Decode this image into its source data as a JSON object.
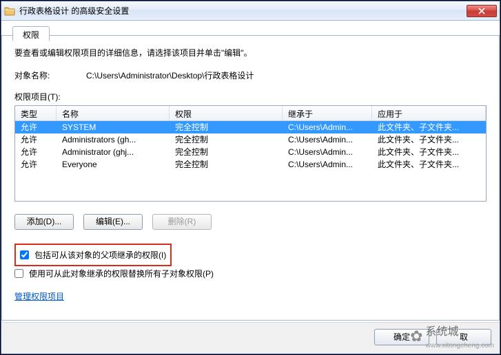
{
  "window": {
    "title": "行政表格设计 的高级安全设置"
  },
  "tab": {
    "label": "权限"
  },
  "instruction": "要查看或编辑权限项目的详细信息，请选择该项目并单击\"编辑\"。",
  "object": {
    "label": "对象名称:",
    "value": "C:\\Users\\Administrator\\Desktop\\行政表格设计"
  },
  "permlist": {
    "label": "权限项目(T):",
    "columns": {
      "type": "类型",
      "name": "名称",
      "perm": "权限",
      "inherit": "继承于",
      "apply": "应用于"
    },
    "rows": [
      {
        "type": "允许",
        "name": "SYSTEM",
        "perm": "完全控制",
        "inherit": "C:\\Users\\Admin...",
        "apply": "此文件夹、子文件夹..."
      },
      {
        "type": "允许",
        "name": "Administrators (gh...",
        "perm": "完全控制",
        "inherit": "C:\\Users\\Admin...",
        "apply": "此文件夹、子文件夹..."
      },
      {
        "type": "允许",
        "name": "Administrator (ghj...",
        "perm": "完全控制",
        "inherit": "C:\\Users\\Admin...",
        "apply": "此文件夹、子文件夹..."
      },
      {
        "type": "允许",
        "name": "Everyone",
        "perm": "完全控制",
        "inherit": "C:\\Users\\Admin...",
        "apply": "此文件夹、子文件夹..."
      }
    ]
  },
  "buttons": {
    "add": "添加(D)...",
    "edit": "编辑(E)...",
    "remove": "删除(R)"
  },
  "checkboxes": {
    "include_inherit": "包括可从该对象的父项继承的权限(I)",
    "replace_child": "使用可从此对象继承的权限替换所有子对象权限(P)"
  },
  "link": "管理权限项目",
  "footer": {
    "ok": "确定",
    "cancel": "取"
  },
  "watermark": {
    "text": "系统城",
    "url": "www.xitongcheng.com"
  }
}
